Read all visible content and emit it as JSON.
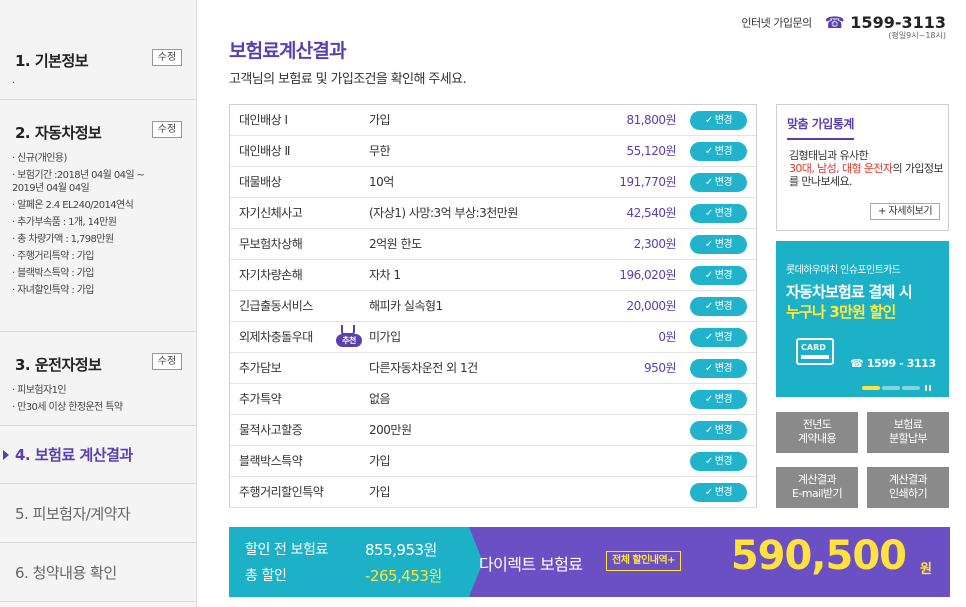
{
  "header": {
    "inquiry_label": "인터넷 가입문의",
    "phone_icon": "phone-icon",
    "phone": "1599-3113",
    "hours": "(평일9시~18시)"
  },
  "page": {
    "title": "보험료계산결과",
    "subtitle": "고객님의 보험료 및 가입조건을 확인해 주세요."
  },
  "sidebar": {
    "edit_label": "수정",
    "basic": {
      "title": "1. 기본정보",
      "items": [
        "."
      ]
    },
    "car": {
      "title": "2. 자동차정보",
      "items": [
        "신규(개인용)",
        "보험기간 :2018년 04월 04일 ~ 2019년 04월 04일",
        "알페온 2.4 EL240/2014연식",
        "추가부속품 : 1개, 14만원",
        "총 차량가액 : 1,798만원",
        "주행거리특약 : 가입",
        "블랙박스특약 : 가입",
        "자녀할인특약 : 가입"
      ]
    },
    "driver": {
      "title": "3. 운전자정보",
      "items": [
        "피보험자1인",
        "만30세 이상 한정운전 특약"
      ]
    },
    "steps": [
      {
        "label": "4. 보험료 계산결과",
        "active": true
      },
      {
        "label": "5. 피보험자/계약자",
        "active": false
      },
      {
        "label": "6. 청약내용 확인",
        "active": false
      }
    ]
  },
  "coverage": {
    "change_label": "변경",
    "recommend_label": "추천",
    "rows": [
      {
        "name": "대인배상 Ⅰ",
        "value": "가입",
        "premium": "81,800원"
      },
      {
        "name": "대인배상 Ⅱ",
        "value": "무한",
        "premium": "55,120원"
      },
      {
        "name": "대물배상",
        "value": "10억",
        "premium": "191,770원"
      },
      {
        "name": "자기신체사고",
        "value": "(자상1) 사망:3억 부상:3천만원",
        "premium": "42,540원"
      },
      {
        "name": "무보험차상해",
        "value": "2억원 한도",
        "premium": "2,300원"
      },
      {
        "name": "자기차량손해",
        "value": "자차 1",
        "premium": "196,020원"
      },
      {
        "name": "긴급출동서비스",
        "value": "해피카 실속형1",
        "premium": "20,000원"
      },
      {
        "name": "외제차충돌우대",
        "value": "미가입",
        "premium": "0원"
      },
      {
        "name": "추가담보",
        "value": "다른자동차운전 외 1건",
        "premium": "950원"
      },
      {
        "name": "추가특약",
        "value": "없음",
        "premium": ""
      },
      {
        "name": "물적사고할증",
        "value": "200만원",
        "premium": ""
      },
      {
        "name": "블랙박스특약",
        "value": "가입",
        "premium": ""
      },
      {
        "name": "주행거리할인특약",
        "value": "가입",
        "premium": ""
      }
    ]
  },
  "stats": {
    "title": "맞춤 가입통계",
    "text_a": "김형태님과 유사한",
    "text_red": "30대, 남성, 대형 운전자",
    "text_b": "의 가입정보를 만나보세요.",
    "more_label": "+ 자세히보기"
  },
  "promo": {
    "small": "롯데하우머치 인슈포인트카드",
    "line1": "자동차보험료 결제 시",
    "line2": "누구나 3만원 할인",
    "card_label": "CARD",
    "phone": "☎ 1599 - 3113"
  },
  "grid_buttons": [
    {
      "l1": "전년도",
      "l2": "계약내용"
    },
    {
      "l1": "보험료",
      "l2": "분할납부"
    },
    {
      "l1": "계산결과",
      "l2": "E-mail받기"
    },
    {
      "l1": "계산결과",
      "l2": "인쇄하기"
    }
  ],
  "summary": {
    "before_label": "할인 전 보험료",
    "before_value": "855,953원",
    "discount_label": "총 할인",
    "discount_value": "-265,453원",
    "direct_label": "다이렉트 보험료",
    "discount_detail_label": "전체 할인내역+",
    "final_amount": "590,500",
    "final_unit": "원"
  },
  "colors": {
    "purple": "#5a3fb0",
    "teal": "#1cb1c7",
    "yellow": "#ffe23d",
    "red": "#e0352b"
  }
}
